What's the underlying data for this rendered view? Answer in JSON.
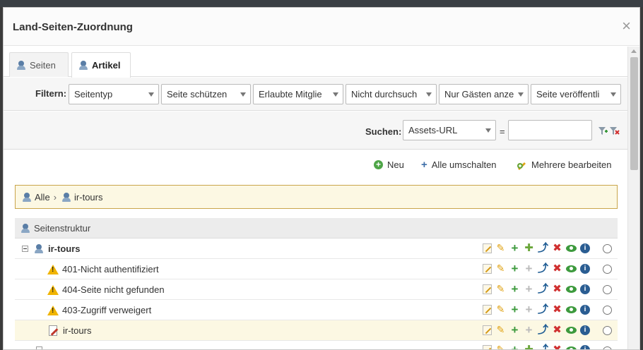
{
  "dialog": {
    "title": "Land-Seiten-Zuordnung",
    "close_glyph": "×"
  },
  "tabs": [
    {
      "label": "Seiten",
      "active": false,
      "icon": "user-icon"
    },
    {
      "label": "Artikel",
      "active": true,
      "icon": "user-icon"
    }
  ],
  "filters": {
    "label": "Filtern:",
    "selects": [
      "Seitentyp",
      "Seite schützen",
      "Erlaubte Mitglie",
      "Nicht durchsuch",
      "Nur Gästen anze",
      "Seite veröffentli"
    ]
  },
  "search": {
    "label": "Suchen:",
    "field_select": "Assets-URL",
    "operator": "=",
    "value": "",
    "add_filter_icon": "filter-add-icon",
    "clear_filter_icon": "filter-clear-icon"
  },
  "actions": {
    "new_label": "Neu",
    "toggle_all_label": "Alle umschalten",
    "edit_multiple_label": "Mehrere bearbeiten"
  },
  "breadcrumb": {
    "items": [
      "Alle",
      "ir-tours"
    ],
    "separator": "›"
  },
  "tree": {
    "header": "Seitenstruktur",
    "rows": [
      {
        "label": "ir-tours",
        "bold": true,
        "icon": "user-icon",
        "expanded": true
      },
      {
        "label": "401-Nicht authentifiziert",
        "icon": "warning-icon"
      },
      {
        "label": "404-Seite nicht gefunden",
        "icon": "warning-icon"
      },
      {
        "label": "403-Zugriff verweigert",
        "icon": "warning-icon"
      },
      {
        "label": "ir-tours",
        "icon": "page-edit-icon",
        "highlighted": true
      }
    ]
  },
  "colors": {
    "accent_green": "#3d9a3d",
    "delete_red": "#d03030",
    "info_blue": "#2a5d92",
    "highlight": "#fcf8e3"
  }
}
